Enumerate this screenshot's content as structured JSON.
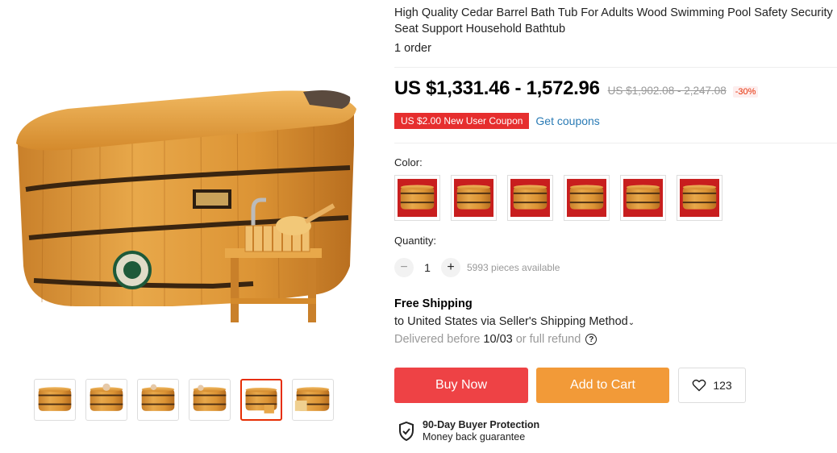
{
  "product": {
    "title": "High Quality Cedar Barrel Bath Tub For Adults Wood Swimming Pool Safety Security Seat Support Household Bathtub",
    "orders": "1 order"
  },
  "gallery": {
    "thumbnails": [
      "thumb-1",
      "thumb-2",
      "thumb-3",
      "thumb-4",
      "thumb-5",
      "thumb-6"
    ],
    "active_index": 5
  },
  "pricing": {
    "price": "US $1,331.46 - 1,572.96",
    "original_price": "US $1,902.08 - 2,247.08",
    "discount": "-30%",
    "coupon": "US $2.00 New User Coupon",
    "get_coupons": "Get coupons"
  },
  "color": {
    "label": "Color:",
    "swatch_count": 6
  },
  "quantity": {
    "label": "Quantity:",
    "minus": "−",
    "value": "1",
    "plus": "+",
    "available": "5993 pieces available"
  },
  "shipping": {
    "title": "Free Shipping",
    "to": "to United States via Seller's Shipping Method",
    "delivered_prefix": "Delivered before",
    "delivered_date": "10/03",
    "delivered_suffix": "or full refund",
    "help": "?"
  },
  "actions": {
    "buy_now": "Buy Now",
    "add_to_cart": "Add to Cart",
    "wishlist_count": "123"
  },
  "protection": {
    "title": "90-Day Buyer Protection",
    "subtitle": "Money back guarantee"
  },
  "colors": {
    "price_red": "#ee4245",
    "cart_orange": "#f29a38",
    "link_blue": "#2a7bb5",
    "coupon_red": "#e62e2e",
    "wood": "#d9952f"
  }
}
